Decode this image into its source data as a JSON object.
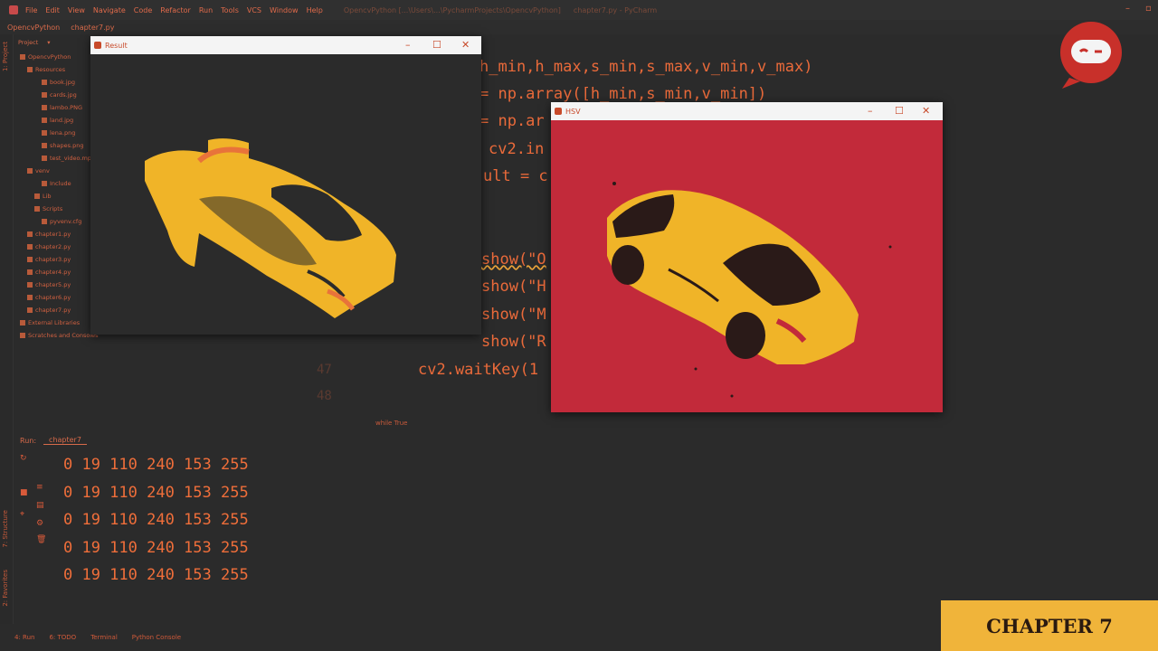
{
  "menubar": {
    "items": [
      "File",
      "Edit",
      "View",
      "Navigate",
      "Code",
      "Refactor",
      "Run",
      "Tools",
      "VCS",
      "Window",
      "Help"
    ],
    "title": "OpencvPython [...\\Users\\...\\PycharmProjects\\OpencvPython]",
    "file_title": "chapter7.py - PyCharm"
  },
  "breadcrumb": {
    "project": "OpencvPython",
    "file": "chapter7.py"
  },
  "sidebar": {
    "project_tab": "1: Project",
    "structure_tab": "7: Structure",
    "favorites_tab": "2: Favorites"
  },
  "project_panel": {
    "header": "Project",
    "items": [
      {
        "label": "OpencvPython",
        "indent": 1
      },
      {
        "label": "Resources",
        "indent": 2
      },
      {
        "label": "book.jpg",
        "indent": 4
      },
      {
        "label": "cards.jpg",
        "indent": 4
      },
      {
        "label": "lambo.PNG",
        "indent": 4
      },
      {
        "label": "land.jpg",
        "indent": 4
      },
      {
        "label": "lena.png",
        "indent": 4
      },
      {
        "label": "shapes.png",
        "indent": 4
      },
      {
        "label": "test_video.mp4",
        "indent": 4
      },
      {
        "label": "venv",
        "indent": 2
      },
      {
        "label": "Include",
        "indent": 4
      },
      {
        "label": "Lib",
        "indent": 3
      },
      {
        "label": "Scripts",
        "indent": 3
      },
      {
        "label": "pyvenv.cfg",
        "indent": 4
      },
      {
        "label": "chapter1.py",
        "indent": 2
      },
      {
        "label": "chapter2.py",
        "indent": 2
      },
      {
        "label": "chapter3.py",
        "indent": 2
      },
      {
        "label": "chapter4.py",
        "indent": 2
      },
      {
        "label": "chapter5.py",
        "indent": 2
      },
      {
        "label": "chapter6.py",
        "indent": 2
      },
      {
        "label": "chapter7.py",
        "indent": 2
      },
      {
        "label": "External Libraries",
        "indent": 1
      },
      {
        "label": "Scratches and Consoles",
        "indent": 1
      }
    ]
  },
  "code": {
    "lines": [
      "h_min,h_max,s_min,s_max,v_min,v_max)",
      "= np.array([h_min,s_min,v_min])",
      "= np.ar",
      "cv2.in",
      "ult = c",
      "show(\"O",
      "show(\"H",
      "show(\"M",
      "show(\"R",
      "cv2.waitKey(1"
    ],
    "line_numbers": [
      "47",
      "48"
    ],
    "hint": "while True"
  },
  "result_window": {
    "title": "Result"
  },
  "hsv_window": {
    "title": "HSV"
  },
  "run_panel": {
    "run_label": "Run:",
    "tab": "chapter7",
    "output": [
      "0 19 110 240 153 255",
      "0 19 110 240 153 255",
      "0 19 110 240 153 255",
      "0 19 110 240 153 255",
      "0 19 110 240 153 255"
    ]
  },
  "bottom_bar": {
    "items": [
      "4: Run",
      "6: TODO",
      "Terminal",
      "Python Console"
    ]
  },
  "badge": {
    "text": "CHAPTER 7"
  },
  "colors": {
    "accent": "#ef6e3a",
    "hsv_background": "#c22a3a",
    "car_yellow": "#f0b428",
    "badge_bg": "#f0b43a"
  }
}
